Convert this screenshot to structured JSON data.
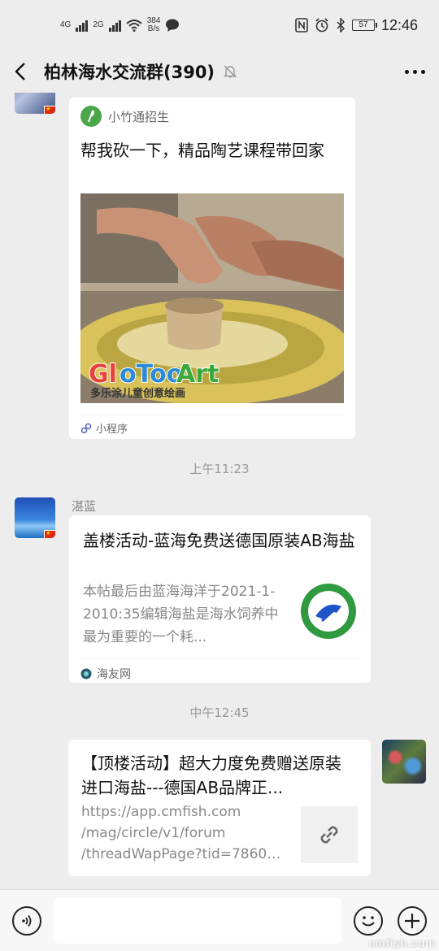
{
  "status_bar": {
    "net_type_1": "4G",
    "net_type_2": "2G",
    "speed_value": "384",
    "speed_unit": "B/s",
    "battery": "57",
    "time": "12:46"
  },
  "header": {
    "title": "柏林海水交流群(390)"
  },
  "messages": {
    "mini_program": {
      "app_name": "小竹通招生",
      "title": "帮我砍一下，精品陶艺课程带回家",
      "image_brand": "GloTooArt",
      "image_caption": "多乐涂儿童创意绘画",
      "footer_label": "小程序"
    },
    "time_1": "上午11:23",
    "article": {
      "sender": "湛蓝",
      "title": "盖楼活动-蓝海免费送德国原装AB海盐",
      "description": "本帖最后由蓝海海洋于2021-1-2010:35编辑海盐是海水饲养中最为重要的一个耗...",
      "source": "海友网"
    },
    "time_2": "中午12:45",
    "link": {
      "title": "【顶楼活动】超大力度免费赠送原装进口海盐---德国AB品牌正...",
      "url_1": "https://app.cmfish.com",
      "url_2": "/mag/circle/v1/forum",
      "url_3": "/threadWapPage?tid=78601..."
    }
  },
  "input": {
    "placeholder": ""
  },
  "watermark": "cmfish.com",
  "colors": {
    "background": "#ededed",
    "card": "#ffffff",
    "mini_program_green": "#4aa64a"
  }
}
